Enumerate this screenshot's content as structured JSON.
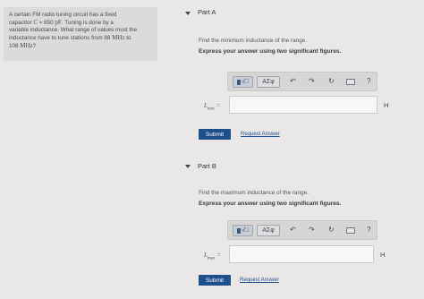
{
  "problem": {
    "line1": "A certain FM radio tuning circuit has a fixed",
    "line2_pre": "capacitor ",
    "line2_var": "C",
    "line2_eq": " = 850 ",
    "line2_unit": "pF",
    "line2_post": ". Tuning is done by a",
    "line3": "variable inductance. What range of values must the",
    "line4_pre": "inductance have to tune stations from 88 ",
    "line4_unit": "MHz",
    "line4_post": " to",
    "line5_val": "108 ",
    "line5_unit": "MHz",
    "line5_post": "?"
  },
  "parts": [
    {
      "title": "Part A",
      "prompt": "Find the minimum inductance of the range.",
      "instruction": "Express your answer using two significant figures.",
      "var_main": "L",
      "var_sub": "min",
      "equals": "=",
      "value": "",
      "unit": "H",
      "submit_label": "Submit",
      "request_label": "Request Answer"
    },
    {
      "title": "Part B",
      "prompt": "Find the maximum inductance of the range.",
      "instruction": "Express your answer using two significant figures.",
      "var_main": "L",
      "var_sub": "max",
      "equals": "=",
      "value": "",
      "unit": "H",
      "submit_label": "Submit",
      "request_label": "Request Answer"
    }
  ],
  "toolbar": {
    "template_label": "√□",
    "greek_label": "ΑΣφ",
    "undo": "↶",
    "redo": "↷",
    "reset": "↻",
    "help": "?"
  },
  "colors": {
    "submit_bg": "#1e4f8c",
    "link": "#1f4e93",
    "background": "#eae8e6"
  }
}
